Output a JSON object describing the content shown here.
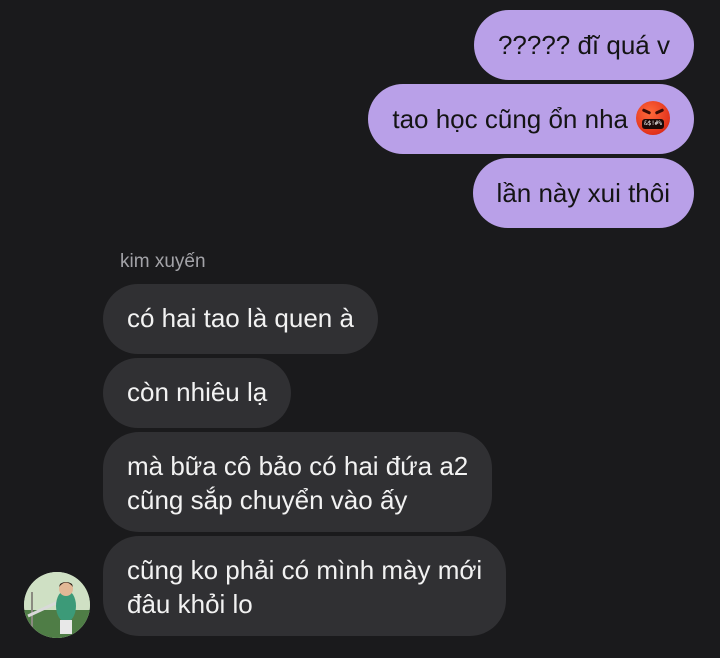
{
  "outgoing_messages": [
    {
      "text": "????? đĩ quá v"
    },
    {
      "text": "tao học cũng ổn nha",
      "emoji": "face-with-symbols-on-mouth",
      "emoji_text": "&$!#%"
    },
    {
      "text": "lần này xui thôi"
    }
  ],
  "sender_name": "kim xuyến",
  "incoming_messages": [
    {
      "lines": [
        "có hai tao là quen à"
      ]
    },
    {
      "lines": [
        "còn nhiêu lạ"
      ]
    },
    {
      "lines": [
        "mà bữa cô bảo có hai đứa a2",
        "cũng sắp chuyển vào ấy"
      ]
    },
    {
      "lines": [
        "cũng ko phải có mình mày mới",
        "đâu khỏi lo"
      ]
    }
  ],
  "avatar": {
    "icon": "profile-photo-avatar"
  },
  "colors": {
    "background": "#1a1a1c",
    "outgoing_bubble": "#b9a0e8",
    "incoming_bubble": "#303033",
    "sender_name": "#a3a3a8"
  }
}
